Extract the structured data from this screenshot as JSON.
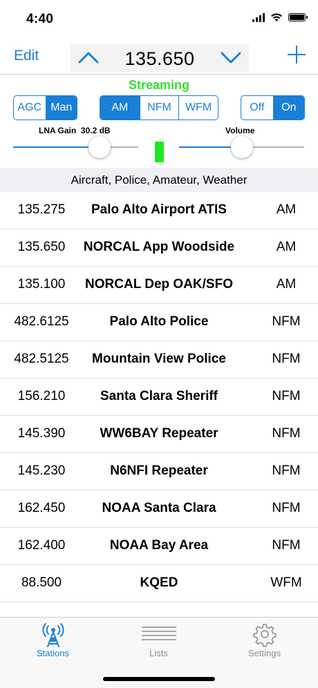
{
  "status_bar": {
    "time": "4:40"
  },
  "nav": {
    "edit_label": "Edit",
    "frequency": "135.650"
  },
  "status": {
    "streaming_text": "Streaming"
  },
  "gain_mode": {
    "options": [
      "AGC",
      "Man"
    ],
    "selected": "Man"
  },
  "demod_mode": {
    "options": [
      "AM",
      "NFM",
      "WFM"
    ],
    "selected": "AM"
  },
  "power": {
    "options": [
      "Off",
      "On"
    ],
    "selected": "On"
  },
  "lna": {
    "label": "LNA Gain",
    "value_text": "30.2 dB",
    "level_fraction": 0.69
  },
  "volume": {
    "label": "Volume",
    "level_fraction": 0.5
  },
  "list_header": "Aircraft, Police, Amateur, Weather",
  "stations": [
    {
      "freq": "135.275",
      "name": "Palo Alto Airport ATIS",
      "mode": "AM"
    },
    {
      "freq": "135.650",
      "name": "NORCAL App Woodside",
      "mode": "AM"
    },
    {
      "freq": "135.100",
      "name": "NORCAL Dep OAK/SFO",
      "mode": "AM"
    },
    {
      "freq": "482.6125",
      "name": "Palo Alto Police",
      "mode": "NFM"
    },
    {
      "freq": "482.5125",
      "name": "Mountain View Police",
      "mode": "NFM"
    },
    {
      "freq": "156.210",
      "name": "Santa Clara Sheriff",
      "mode": "NFM"
    },
    {
      "freq": "145.390",
      "name": "WW6BAY Repeater",
      "mode": "NFM"
    },
    {
      "freq": "145.230",
      "name": "N6NFI Repeater",
      "mode": "NFM"
    },
    {
      "freq": "162.450",
      "name": "NOAA Santa Clara",
      "mode": "NFM"
    },
    {
      "freq": "162.400",
      "name": "NOAA Bay Area",
      "mode": "NFM"
    },
    {
      "freq": "88.500",
      "name": "KQED",
      "mode": "WFM"
    }
  ],
  "tabs": [
    {
      "label": "Stations",
      "icon": "antenna-icon",
      "active": true
    },
    {
      "label": "Lists",
      "icon": "list-icon",
      "active": false
    },
    {
      "label": "Settings",
      "icon": "gear-icon",
      "active": false
    }
  ],
  "colors": {
    "accent": "#1a7fd6",
    "streaming": "#33e033",
    "level_meter": "#1fe61f"
  }
}
